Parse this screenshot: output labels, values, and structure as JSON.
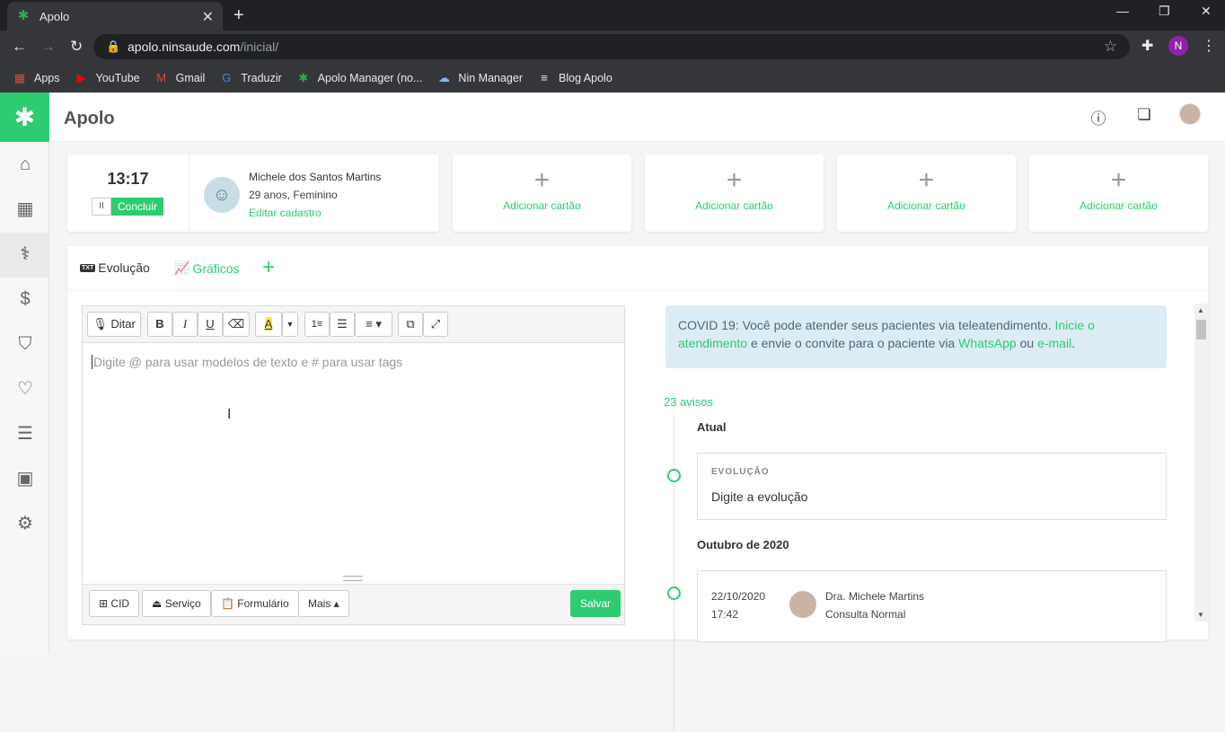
{
  "browser": {
    "tab_title": "Apolo",
    "url_domain": "apolo.ninsaude.com",
    "url_path": "/inicial/",
    "profile_initial": "N",
    "bookmarks": [
      {
        "label": "Apps",
        "icon": "apps-grid-icon",
        "color": "#ea4335"
      },
      {
        "label": "YouTube",
        "icon": "youtube-icon",
        "color": "#ff0000"
      },
      {
        "label": "Gmail",
        "icon": "gmail-icon",
        "color": "#ea4335"
      },
      {
        "label": "Traduzir",
        "icon": "translate-icon",
        "color": "#4285f4"
      },
      {
        "label": "Apolo Manager (no...",
        "icon": "apolo-icon",
        "color": "#34a853"
      },
      {
        "label": "Nin Manager",
        "icon": "cloud-icon",
        "color": "#8ab4f8"
      },
      {
        "label": "Blog Apolo",
        "icon": "blog-icon",
        "color": "#e8eaed"
      }
    ]
  },
  "app": {
    "brand": "Apolo",
    "accent": "#2ecc71"
  },
  "clock": {
    "time": "13:17",
    "pause_label": "II",
    "finish_label": "Concluir"
  },
  "patient": {
    "name": "Michele dos Santos Martins",
    "info": "29 anos, Feminino",
    "edit_label": "Editar cadastro"
  },
  "add_cards": [
    {
      "label": "Adicionar cartão"
    },
    {
      "label": "Adicionar cartão"
    },
    {
      "label": "Adicionar cartão"
    },
    {
      "label": "Adicionar cartão"
    }
  ],
  "tabs": {
    "evolucao_badge": "TXT",
    "evolucao": "Evolução",
    "graficos": "Gráficos",
    "add": "+"
  },
  "editor": {
    "dictate_label": "Ditar",
    "placeholder": "Digite @ para usar modelos de texto e # para usar tags",
    "footer": {
      "cid": "CID",
      "servico": "Serviço",
      "formulario": "Formulário",
      "mais": "Mais ▴",
      "save": "Salvar"
    }
  },
  "covid": {
    "text_1": "COVID 19: Você pode atender seus pacientes via teleatendimento. ",
    "link_1": "Inicie o atendimento",
    "text_2": " e envie o convite para o paciente via ",
    "link_2": "WhatsApp",
    "text_3": " ou ",
    "link_3": "e-mail",
    "text_4": "."
  },
  "timeline": {
    "avisos": "23 avisos",
    "section_current": "Atual",
    "evo_label": "EVOLUÇÃO",
    "evo_placeholder": "Digite a evolução",
    "section_month": "Outubro de 2020",
    "history": [
      {
        "date": "22/10/2020",
        "time": "17:42",
        "doctor": "Dra. Michele Martins",
        "type": "Consulta Normal"
      }
    ]
  }
}
